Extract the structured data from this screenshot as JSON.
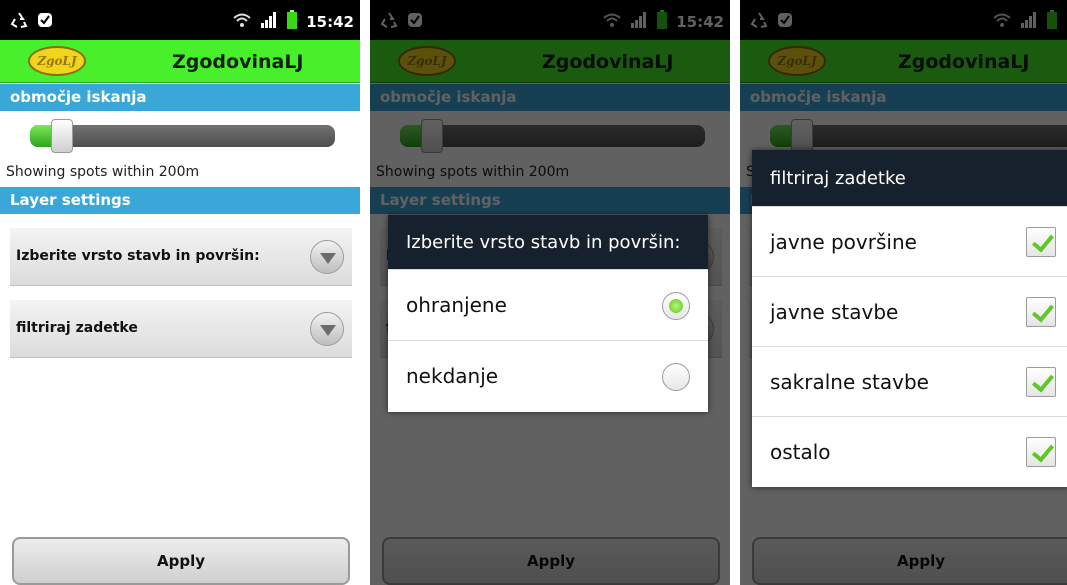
{
  "status_bar": {
    "time": "15:42"
  },
  "app": {
    "title": "ZgodovinaLJ",
    "logo_text": "ZgoLJ"
  },
  "search_area": {
    "header": "območje iskanja",
    "slider_value_m": 200,
    "slider_level": 0.07,
    "caption": "Showing spots within 200m"
  },
  "layer_settings": {
    "header": "Layer settings",
    "type_label": "Izberite vrsto stavb in površin:",
    "filter_label": "filtriraj zadetke"
  },
  "apply_button": {
    "label": "Apply"
  },
  "type_dialog": {
    "title": "Izberite vrsto stavb in površin:",
    "options": [
      {
        "label": "ohranjene",
        "selected": true
      },
      {
        "label": "nekdanje",
        "selected": false
      }
    ]
  },
  "filter_dialog": {
    "title": "filtriraj zadetke",
    "options": [
      {
        "label": "javne površine",
        "checked": true
      },
      {
        "label": "javne stavbe",
        "checked": true
      },
      {
        "label": "sakralne stavbe",
        "checked": true
      },
      {
        "label": "ostalo",
        "checked": true
      }
    ]
  },
  "colors": {
    "titlebar": "#47f02a",
    "section_header": "#3aa7d9",
    "dialog_title": "#17212d",
    "accent_green": "#5ec826"
  },
  "icons": [
    "recycle-icon",
    "shield-notification-icon",
    "wifi-icon",
    "signal-icon",
    "battery-icon",
    "dropdown-arrow-icon"
  ]
}
